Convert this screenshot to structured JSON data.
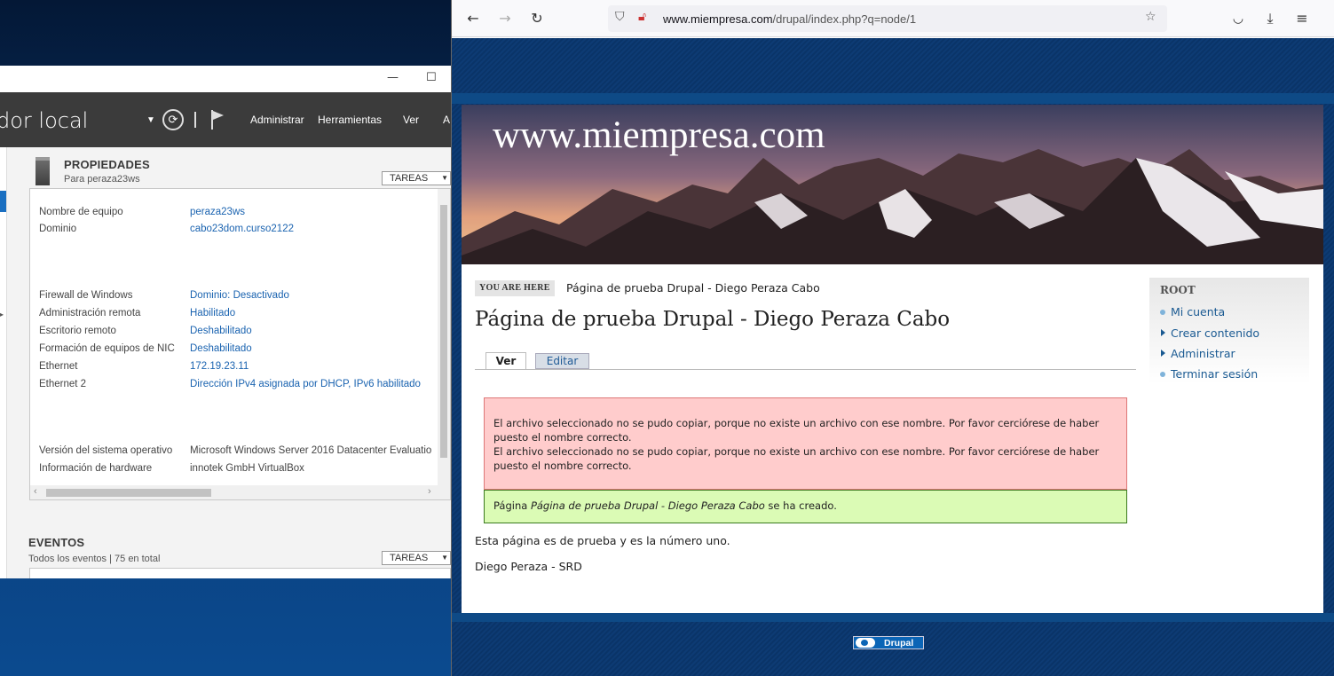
{
  "server_manager": {
    "title": "dor local",
    "window_buttons": {
      "minimize": "—",
      "maximize": "☐"
    },
    "menu": [
      "Administrar",
      "Herramientas",
      "Ver",
      "A"
    ],
    "properties": {
      "title": "PROPIEDADES",
      "subtitle": "Para peraza23ws",
      "tasks_label": "TAREAS",
      "rows": [
        {
          "key": "Nombre de equipo",
          "value": "peraza23ws"
        },
        {
          "key": "Dominio",
          "value": "cabo23dom.curso2122"
        },
        {
          "key": "Firewall de Windows",
          "value": "Dominio: Desactivado"
        },
        {
          "key": "Administración remota",
          "value": "Habilitado"
        },
        {
          "key": "Escritorio remoto",
          "value": "Deshabilitado"
        },
        {
          "key": "Formación de equipos de NIC",
          "value": "Deshabilitado"
        },
        {
          "key": "Ethernet",
          "value": "172.19.23.11"
        },
        {
          "key": "Ethernet 2",
          "value": "Dirección IPv4 asignada por DHCP, IPv6 habilitado"
        },
        {
          "key": "Versión del sistema operativo",
          "value": "Microsoft Windows Server 2016 Datacenter Evaluatio"
        },
        {
          "key": "Información de hardware",
          "value": "innotek GmbH VirtualBox"
        }
      ]
    },
    "events": {
      "title": "EVENTOS",
      "subtitle": "Todos los eventos | 75 en total",
      "tasks_label": "TAREAS"
    }
  },
  "browser": {
    "url_domain": "www.miempresa.com",
    "url_path": "/drupal/index.php?q=node/1",
    "icons": [
      "back-icon",
      "forward-icon",
      "reload-icon",
      "shield-icon",
      "insecure-lock-icon",
      "bookmark-star-icon",
      "pocket-icon",
      "download-icon",
      "menu-icon"
    ]
  },
  "site": {
    "name": "www.miempresa.com",
    "breadcrumb_label": "YOU ARE HERE",
    "breadcrumb": "Página de prueba Drupal - Diego Peraza Cabo",
    "page_title": "Página de prueba Drupal - Diego Peraza Cabo",
    "tabs": {
      "view": "Ver",
      "edit": "Editar"
    },
    "error_messages": [
      "El archivo seleccionado no se pudo copiar, porque no existe un archivo con ese nombre. Por favor cerciórese de haber puesto el nombre correcto.",
      "El archivo seleccionado no se pudo copiar, porque no existe un archivo con ese nombre. Por favor cerciórese de haber puesto el nombre correcto."
    ],
    "status": {
      "prefix": "Página ",
      "title": "Página de prueba Drupal - Diego Peraza Cabo",
      "suffix": " se ha creado."
    },
    "body": [
      "Esta página es de prueba y es la número uno.",
      "Diego Peraza - SRD"
    ],
    "sidebar": {
      "title": "ROOT",
      "items": [
        "Mi cuenta",
        "Crear contenido",
        "Administrar",
        "Terminar sesión"
      ]
    },
    "footer_badge": "Drupal"
  },
  "colors": {
    "link": "#1a63b0",
    "error_bg": "#ffcccc",
    "status_bg": "#dbfbb5",
    "page_blue": "#0a3468"
  }
}
